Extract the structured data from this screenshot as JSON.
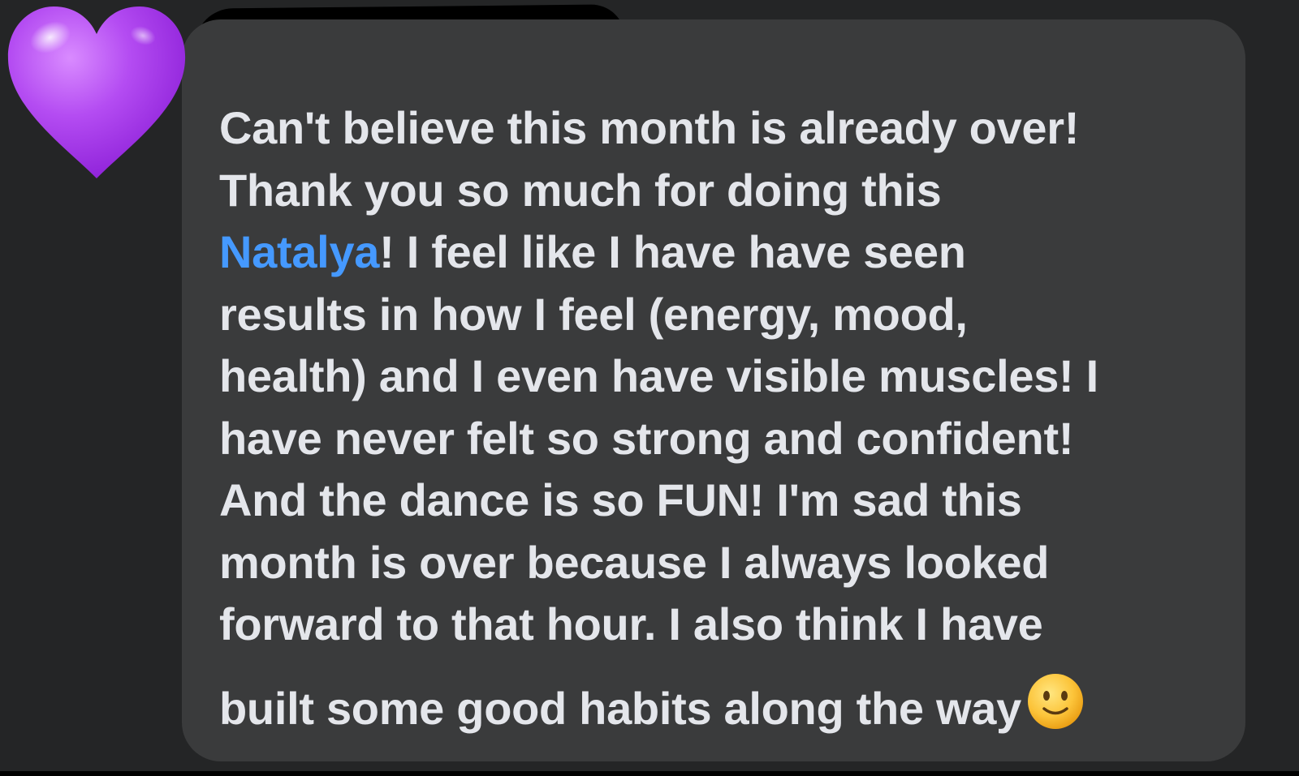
{
  "message": {
    "sender_name_redacted": true,
    "reaction_icon": "purple-heart-icon",
    "mention_color": "#4599ff",
    "bubble_color": "#3a3b3c",
    "lines": {
      "l1": "Can't believe this month is already over!",
      "l2": "Thank you so much for doing this",
      "l3_mention": "Natalya",
      "l3_rest": "! I feel like I have have seen",
      "l4": "results in how I feel (energy, mood,",
      "l5": "health) and I even have visible muscles! I",
      "l6": "have never felt so strong and confident!",
      "l7": "And the dance is so FUN! I'm sad this",
      "l8": "month is over because I always looked",
      "l9": "forward to that hour. I also think I have",
      "l10": "built some good habits along the way"
    },
    "end_emoji": "slightly-smiling-face-icon"
  }
}
